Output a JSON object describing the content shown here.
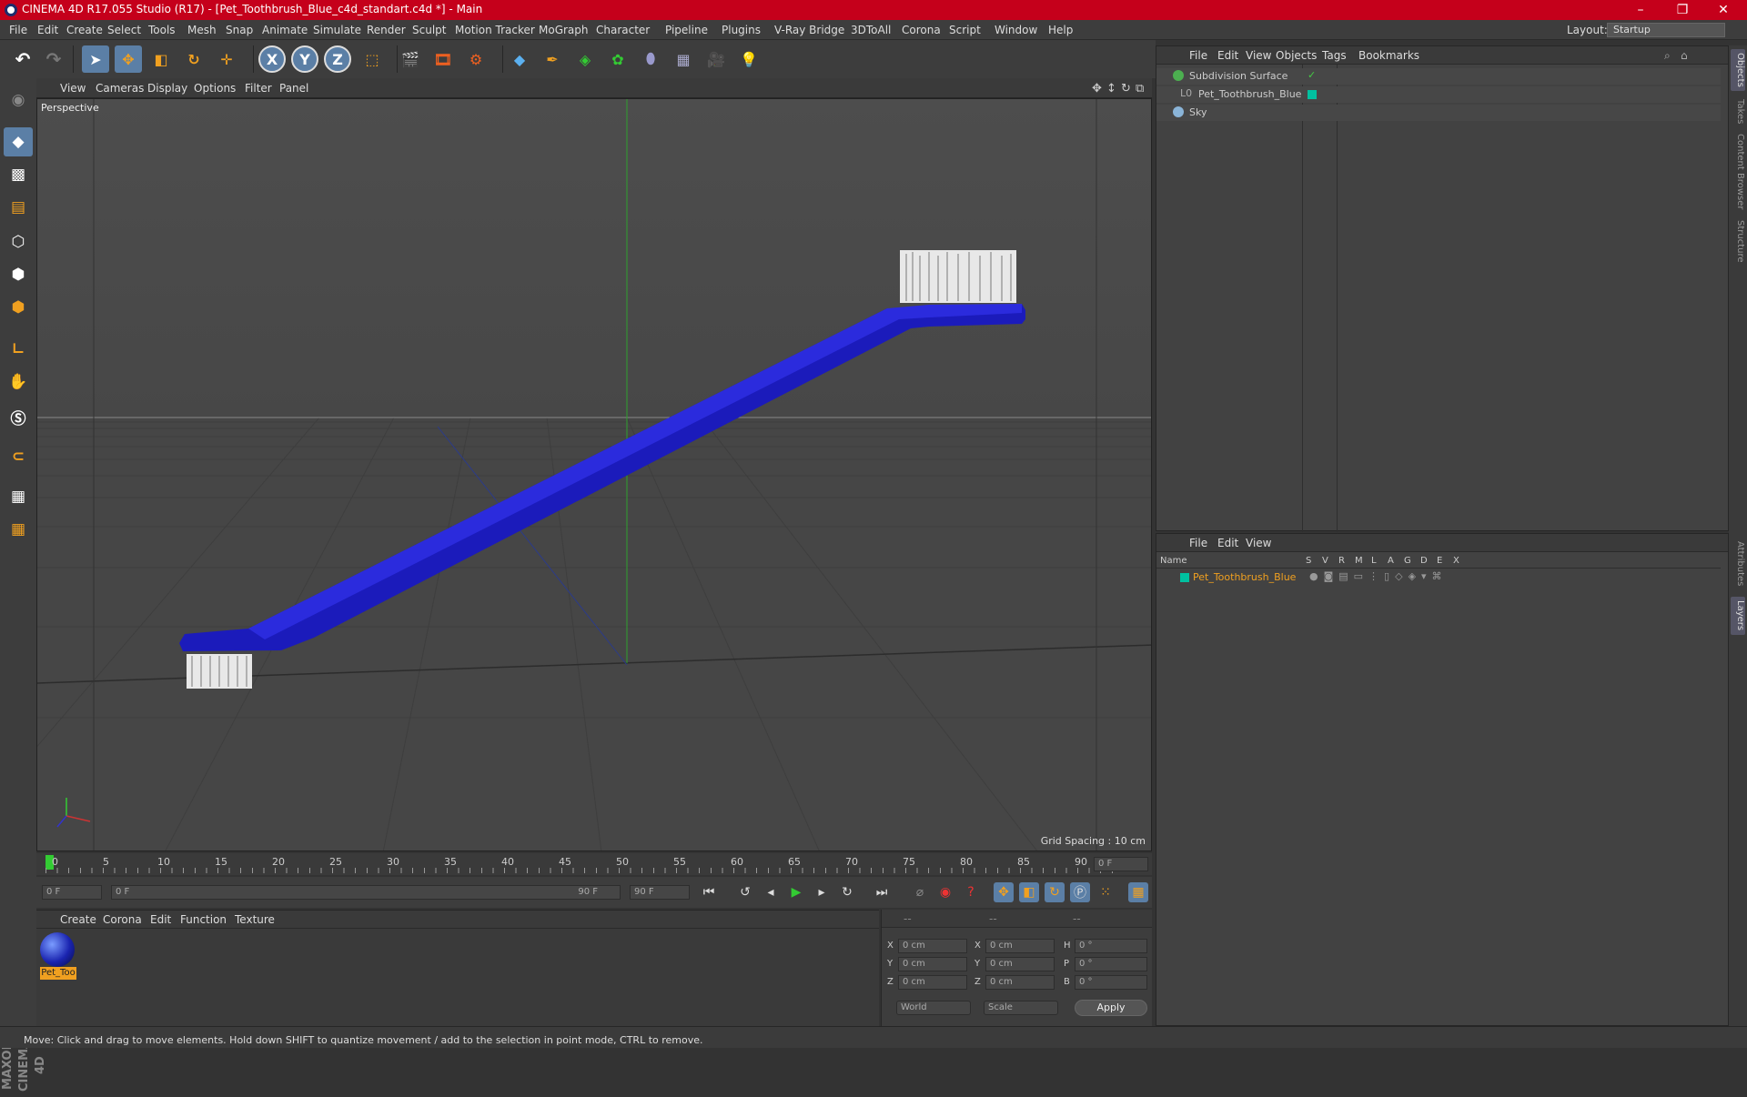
{
  "window": {
    "title": "CINEMA 4D R17.055 Studio (R17) - [Pet_Toothbrush_Blue_c4d_standart.c4d *] - Main",
    "minimize": "–",
    "restore": "❐",
    "close": "✕"
  },
  "menu": [
    "File",
    "Edit",
    "Create",
    "Select",
    "Tools",
    "Mesh",
    "Snap",
    "Animate",
    "Simulate",
    "Render",
    "Sculpt",
    "Motion Tracker",
    "MoGraph",
    "Character",
    "Pipeline",
    "Plugins",
    "V-Ray Bridge",
    "3DToAll",
    "Corona",
    "Script",
    "Window",
    "Help"
  ],
  "layout": {
    "label": "Layout:",
    "value": "Startup"
  },
  "toolbar": {
    "x_axis": "X",
    "y_axis": "Y",
    "z_axis": "Z"
  },
  "viewport": {
    "menu": [
      "View",
      "Cameras",
      "Display",
      "Options",
      "Filter",
      "Panel"
    ],
    "label": "Perspective",
    "grid_spacing": "Grid Spacing : 10 cm"
  },
  "timeline": {
    "ticks": [
      "0",
      "5",
      "10",
      "15",
      "20",
      "25",
      "30",
      "35",
      "40",
      "45",
      "50",
      "55",
      "60",
      "65",
      "70",
      "75",
      "80",
      "85",
      "90"
    ],
    "current_frame": "0 F",
    "start": "0 F",
    "range_start": "0 F",
    "range_end": "90 F",
    "end": "90 F"
  },
  "materials": {
    "menu": [
      "Create",
      "Corona",
      "Edit",
      "Function",
      "Texture"
    ],
    "items": [
      {
        "name": "Pet_Too"
      }
    ]
  },
  "coords": {
    "header": [
      "--",
      "--",
      "--"
    ],
    "rows": [
      {
        "a": "X",
        "av": "0 cm",
        "b": "X",
        "bv": "0 cm",
        "c": "H",
        "cv": "0 °"
      },
      {
        "a": "Y",
        "av": "0 cm",
        "b": "Y",
        "bv": "0 cm",
        "c": "P",
        "cv": "0 °"
      },
      {
        "a": "Z",
        "av": "0 cm",
        "b": "Z",
        "bv": "0 cm",
        "c": "B",
        "cv": "0 °"
      }
    ],
    "world": "World",
    "scale": "Scale",
    "apply": "Apply"
  },
  "object_manager": {
    "menu": [
      "File",
      "Edit",
      "View",
      "Objects",
      "Tags",
      "Bookmarks"
    ],
    "objects": [
      {
        "name": "Subdivision Surface",
        "color": "#4caf50"
      },
      {
        "name": "Pet_Toothbrush_Blue",
        "color": "#aaaaaa"
      },
      {
        "name": "Sky",
        "color": "#8ab4d8"
      }
    ]
  },
  "layer_manager": {
    "menu": [
      "File",
      "Edit",
      "View"
    ],
    "columns": [
      "Name",
      "S",
      "V",
      "R",
      "M",
      "L",
      "A",
      "G",
      "D",
      "E",
      "X"
    ],
    "layers": [
      {
        "name": "Pet_Toothbrush_Blue",
        "color": "#00c0a0"
      }
    ]
  },
  "side_tabs": [
    "Objects",
    "Takes",
    "Content Browser",
    "Structure",
    "Attributes",
    "Layers"
  ],
  "maxon": "MAXON CINEMA 4D",
  "status": "Move: Click and drag to move elements. Hold down SHIFT to quantize movement / add to the selection in point mode, CTRL to remove.",
  "colors": {
    "title_bar": "#c5001b",
    "accent": "#5b9ad5",
    "brush": "#2222cc",
    "highlight_text": "#f0a020"
  }
}
